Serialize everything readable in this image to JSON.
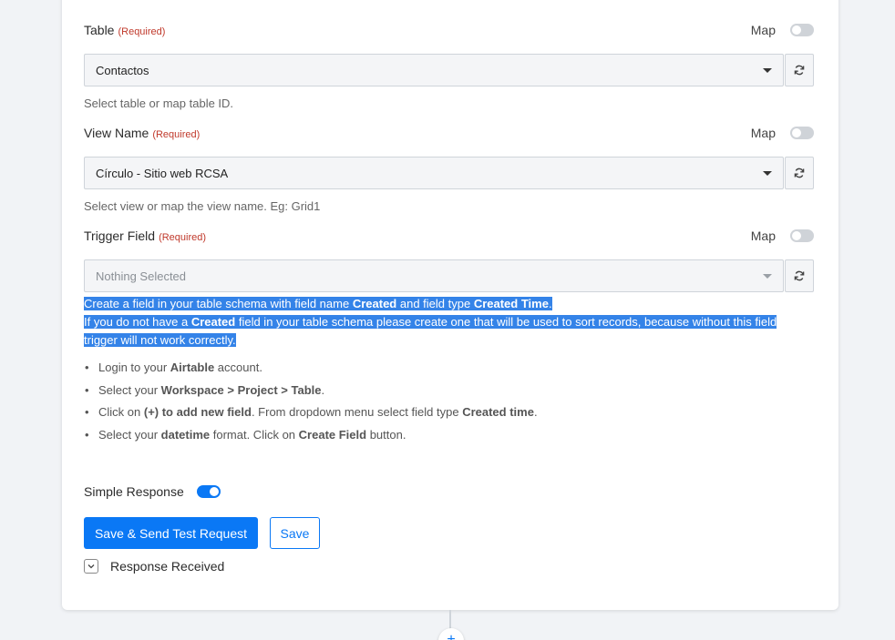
{
  "fields": [
    {
      "label": "Table",
      "required": "(Required)",
      "map_label": "Map",
      "value": "Contactos",
      "hint": "Select table or map table ID."
    },
    {
      "label": "View Name",
      "required": "(Required)",
      "map_label": "Map",
      "value": "Círculo - Sitio web RCSA",
      "hint": "Select view or map the view name. Eg: Grid1"
    },
    {
      "label": "Trigger Field",
      "required": "(Required)",
      "map_label": "Map",
      "placeholder": "Nothing Selected"
    }
  ],
  "info": {
    "line1_a": "Create a field in your table schema with field name ",
    "line1_b": "Created",
    "line1_c": " and field type ",
    "line1_d": "Created Time",
    "line1_e": ".",
    "line2_a": "If you do not have a ",
    "line2_b": "Created",
    "line2_c": " field in your table schema please create one that will be used to sort records, because without this field",
    "line3": "trigger will not work correctly."
  },
  "steps": [
    {
      "a": "Login to your ",
      "b": "Airtable",
      "c": " account."
    },
    {
      "a": "Select your ",
      "b": "Workspace > Project > Table",
      "c": "."
    },
    {
      "a": "Click on ",
      "b": "(+) to add new field",
      "c": ". From dropdown menu select field type ",
      "d": "Created time",
      "e": "."
    },
    {
      "a": "Select your ",
      "b": "datetime",
      "c": " format. Click on ",
      "d": "Create Field",
      "e": " button."
    }
  ],
  "simple_response": {
    "label": "Simple Response",
    "enabled": true
  },
  "buttons": {
    "save_send": "Save & Send Test Request",
    "save": "Save"
  },
  "response_received": "Response Received",
  "colors": {
    "accent": "#0a78f5",
    "highlight": "#3483e8",
    "required": "#c0392b"
  },
  "icons": {
    "refresh": "refresh-icon",
    "caret": "caret-down-icon",
    "chevron": "chevron-down-icon",
    "plus": "plus-icon"
  }
}
